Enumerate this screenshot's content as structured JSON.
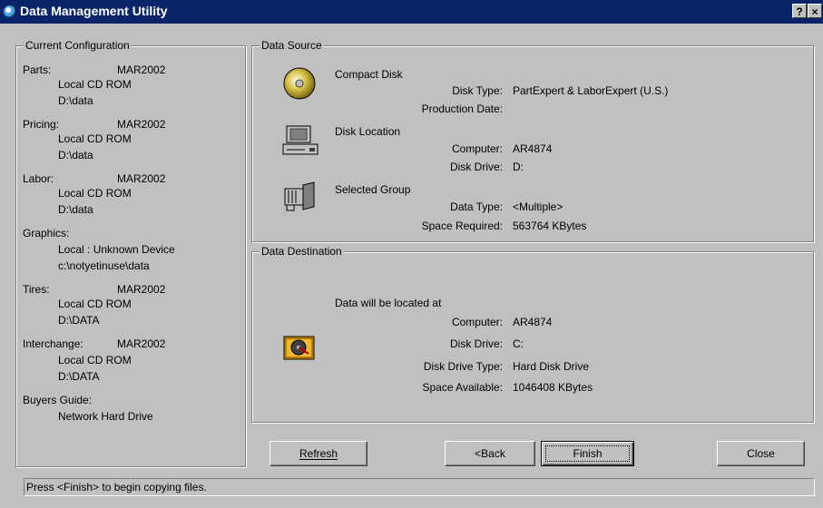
{
  "window": {
    "title": "Data Management Utility",
    "help_button": "?",
    "close_button": "×"
  },
  "config": {
    "title": "Current Configuration",
    "parts": {
      "label": "Parts:",
      "date": "MAR2002",
      "location": "Local CD ROM",
      "path": "D:\\data"
    },
    "pricing": {
      "label": "Pricing:",
      "date": "MAR2002",
      "location": "Local CD ROM",
      "path": "D:\\data"
    },
    "labor": {
      "label": "Labor:",
      "date": "MAR2002",
      "location": "Local CD ROM",
      "path": "D:\\data"
    },
    "graphics": {
      "label": "Graphics:",
      "location": "Local : Unknown Device",
      "path": "c:\\notyetinuse\\data"
    },
    "tires": {
      "label": "Tires:",
      "date": "MAR2002",
      "location": "Local CD ROM",
      "path": "D:\\DATA"
    },
    "interchange": {
      "label": "Interchange:",
      "date": "MAR2002",
      "location": "Local CD ROM",
      "path": "D:\\DATA"
    },
    "buyers_guide": {
      "label": "Buyers Guide:",
      "location": "Network Hard Drive"
    }
  },
  "source": {
    "title": "Data Source",
    "compact_disk": {
      "heading": "Compact Disk",
      "disk_type_label": "Disk Type:",
      "disk_type_value": "PartExpert & LaborExpert (U.S.)",
      "production_date_label": "Production Date:",
      "production_date_value": ""
    },
    "disk_location": {
      "heading": "Disk Location",
      "computer_label": "Computer:",
      "computer_value": "AR4874",
      "drive_label": "Disk Drive:",
      "drive_value": "D:"
    },
    "selected_group": {
      "heading": "Selected Group",
      "data_type_label": "Data Type:",
      "data_type_value": "<Multiple>",
      "space_label": "Space Required:",
      "space_value": "563764 KBytes"
    }
  },
  "destination": {
    "title": "Data Destination",
    "heading": "Data will be located at",
    "computer_label": "Computer:",
    "computer_value": "AR4874",
    "drive_label": "Disk Drive:",
    "drive_value": "C:",
    "drive_type_label": "Disk Drive Type:",
    "drive_type_value": "Hard Disk Drive",
    "space_label": "Space Available:",
    "space_value": "1046408 KBytes"
  },
  "buttons": {
    "refresh": "Refresh",
    "back": "<Back",
    "finish": "Finish",
    "close": "Close"
  },
  "status_text": "Press <Finish> to begin copying files."
}
